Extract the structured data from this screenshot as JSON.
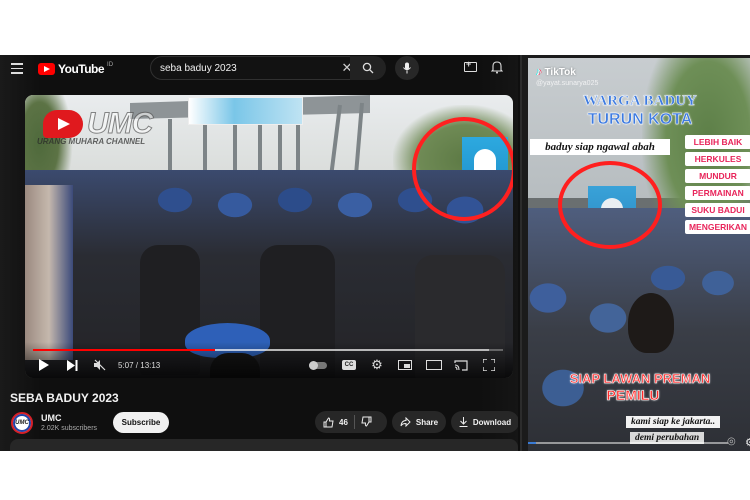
{
  "youtube": {
    "logo_text": "YouTube",
    "logo_superscript": "ID",
    "search": {
      "query": "seba baduy 2023",
      "placeholder": "Search"
    },
    "header_icons": [
      "menu-icon",
      "search-icon",
      "mic-icon",
      "create-icon",
      "notifications-icon"
    ],
    "player": {
      "watermark_brand": "UMC",
      "watermark_sub": "URANG MUHARA CHANNEL",
      "current_time": "5:07",
      "duration": "13:13",
      "time_display": "5:07 / 13:13",
      "progress_fraction": 0.387,
      "buffered_fraction": 0.97,
      "muted": true,
      "controls": [
        "play",
        "next",
        "mute",
        "autoplay",
        "captions",
        "settings",
        "miniplayer",
        "theater",
        "cast",
        "fullscreen"
      ],
      "highlight_color": "#ff2020"
    },
    "video_title": "SEBA BADUY 2023",
    "channel": {
      "avatar_text": "UMC",
      "name": "UMC",
      "subscribers": "2.02K subscribers"
    },
    "actions": {
      "subscribe": "Subscribe",
      "likes": "46",
      "share": "Share",
      "download": "Download"
    },
    "accent_color": "#ff0000"
  },
  "tiktok": {
    "logo_text": "TikTok",
    "username": "@yayat.sunarya025",
    "headline_line1": "WARGA BADUY",
    "headline_line2": "TURUN KOTA",
    "caption": "baduy siap ngawal abah",
    "side_list": [
      "LEBIH BAIK",
      "HERKULES",
      "MUNDUR",
      "PERMAINAN",
      "SUKU BADUI",
      "MENGERIKAN"
    ],
    "bottom_line1": "SIAP LAWAN PREMAN",
    "bottom_line2": "PEMILU",
    "subtitle_line1": "kami siap ke jakarta..",
    "subtitle_line2": "demi perubahan",
    "progress_fraction": 0.04,
    "highlight_color": "#ff1f1f"
  }
}
